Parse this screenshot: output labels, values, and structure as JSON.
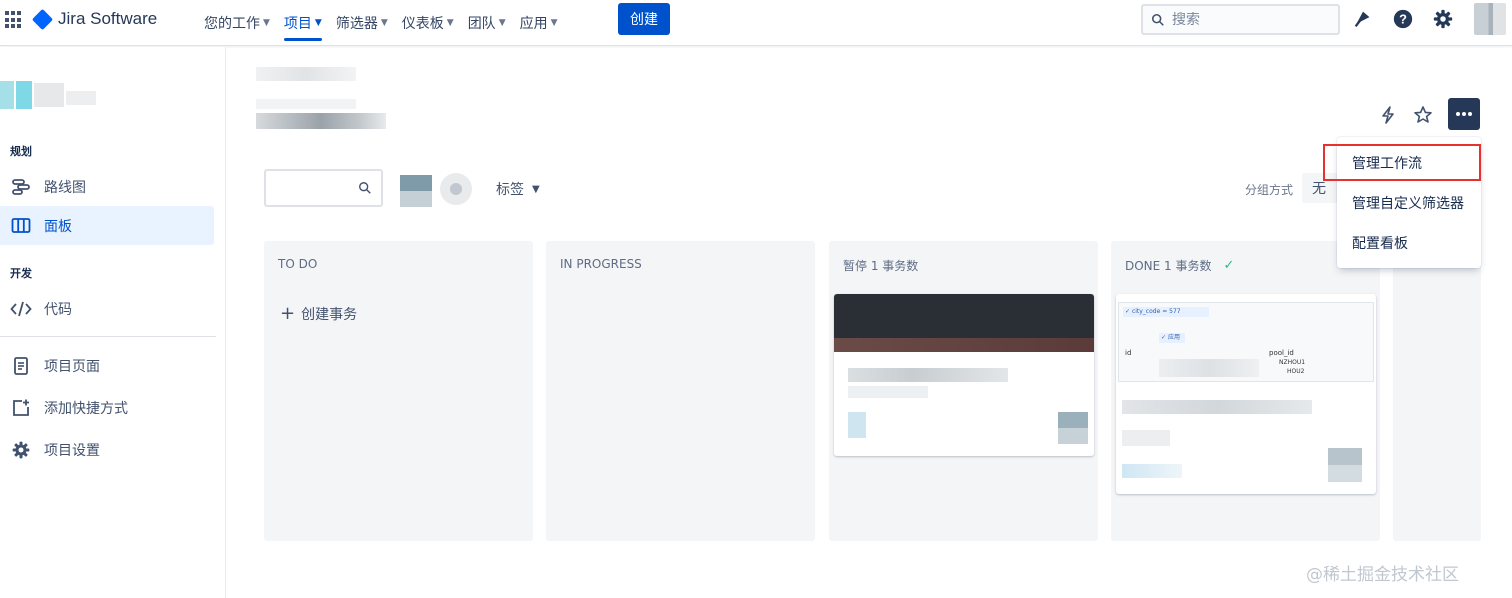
{
  "topbar": {
    "logo": "Jira Software",
    "nav": [
      {
        "label": "您的工作",
        "active": false
      },
      {
        "label": "项目",
        "active": true
      },
      {
        "label": "筛选器",
        "active": false
      },
      {
        "label": "仪表板",
        "active": false
      },
      {
        "label": "团队",
        "active": false
      },
      {
        "label": "应用",
        "active": false
      }
    ],
    "create_label": "创建",
    "search_placeholder": "搜索",
    "icons": [
      "notification-icon",
      "help-icon",
      "settings-icon"
    ]
  },
  "sidebar": {
    "sections": [
      {
        "header": "规划",
        "items": [
          {
            "label": "路线图",
            "icon": "roadmap-icon",
            "active": false
          },
          {
            "label": "面板",
            "icon": "board-icon",
            "active": true
          }
        ]
      },
      {
        "header": "开发",
        "items": [
          {
            "label": "代码",
            "icon": "code-icon",
            "active": false
          }
        ]
      }
    ],
    "bottom_items": [
      {
        "label": "项目页面",
        "icon": "page-icon"
      },
      {
        "label": "添加快捷方式",
        "icon": "add-shortcut-icon"
      },
      {
        "label": "项目设置",
        "icon": "settings-icon"
      }
    ]
  },
  "board": {
    "filters": {
      "label_filter": "标签",
      "group_by_label": "分组方式",
      "group_by_value": "无"
    },
    "columns": [
      {
        "title": "TO DO",
        "create_issue": "创建事务"
      },
      {
        "title": "IN PROGRESS"
      },
      {
        "title": "暂停 1 事务数"
      },
      {
        "title": "DONE 1 事务数",
        "done": true
      }
    ],
    "done_card_snippets": {
      "filter_tag": "city_code",
      "filter_value": "577",
      "apply": "应用",
      "col_id": "id",
      "col_pool": "pool_id",
      "row1": "NZHOU1",
      "row2": "HOU2"
    }
  },
  "menu": {
    "items": [
      "管理工作流",
      "管理自定义筛选器",
      "配置看板"
    ],
    "highlighted_index": 0
  },
  "watermark": "@稀土掘金技术社区"
}
